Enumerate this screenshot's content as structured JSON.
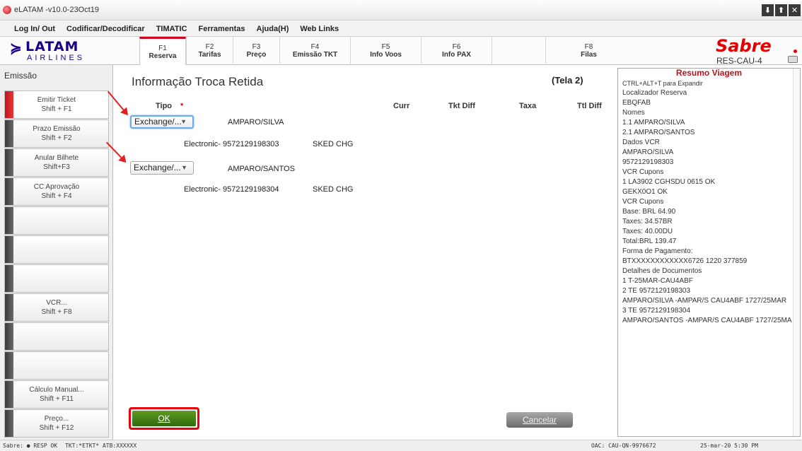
{
  "window": {
    "title": "eLATAM -v10.0-23Oct19",
    "controls": [
      "⬇",
      "⬆",
      "✕"
    ]
  },
  "menu": [
    "Log In/ Out",
    "Codificar/Decodificar",
    "TIMATIC",
    "Ferramentas",
    "Ajuda(H)",
    "Web Links"
  ],
  "logo": {
    "brand": "LATAM",
    "sub": "AIRLINES"
  },
  "fkeys": [
    {
      "key": "F1",
      "label": "Reserva"
    },
    {
      "key": "F2",
      "label": "Tarifas"
    },
    {
      "key": "F3",
      "label": "Preço"
    },
    {
      "key": "F4",
      "label": "Emissão TKT"
    },
    {
      "key": "F5",
      "label": "Info Voos"
    },
    {
      "key": "F6",
      "label": "Info PAX"
    },
    {
      "key": "",
      "label": ""
    },
    {
      "key": "F8",
      "label": "Filas"
    }
  ],
  "sabre": {
    "logo": "Sabre",
    "station": "RES-CAU-4"
  },
  "sidebar": {
    "section": "Emissão",
    "buttons": [
      {
        "label": "Emitir Ticket",
        "shortcut": "Shift + F1"
      },
      {
        "label": "Prazo Emissão",
        "shortcut": "Shift + F2"
      },
      {
        "label": "Anular Bilhete",
        "shortcut": "Shift+F3"
      },
      {
        "label": "CC Aprovação",
        "shortcut": "Shift + F4"
      },
      {
        "label": "",
        "shortcut": ""
      },
      {
        "label": "",
        "shortcut": ""
      },
      {
        "label": "",
        "shortcut": ""
      },
      {
        "label": "VCR...",
        "shortcut": "Shift + F8"
      },
      {
        "label": "",
        "shortcut": ""
      },
      {
        "label": "",
        "shortcut": ""
      },
      {
        "label": "Cálculo Manual...",
        "shortcut": "Shift + F11"
      },
      {
        "label": "Preço...",
        "shortcut": "Shift + F12"
      }
    ]
  },
  "main": {
    "title": "Informação Troca Retida",
    "screen": "(Tela 2)",
    "columns": {
      "tipo": "Tipo",
      "required": "*",
      "curr": "Curr",
      "tkt_diff": "Tkt Diff",
      "taxa": "Taxa",
      "ttl_diff": "Ttl Diff"
    },
    "passengers": [
      {
        "type": "Exchange/...",
        "name": "AMPARO/SILVA",
        "ticket": "Electronic- 9572129198303",
        "status": "SKED CHG"
      },
      {
        "type": "Exchange/...",
        "name": "AMPARO/SANTOS",
        "ticket": "Electronic- 9572129198304",
        "status": "SKED CHG"
      }
    ],
    "ok_label": "OK",
    "cancel_label": "Cancelar"
  },
  "summary": {
    "title": "Resumo Viagem",
    "lines": [
      "CTRL+ALT+T para Expandir",
      "Localizador Reserva",
      "EBQFAB",
      " Nomes",
      "1.1 AMPARO/SILVA",
      "2.1 AMPARO/SANTOS",
      " Dados VCR",
      "AMPARO/SILVA",
      "9572129198303",
      " VCR Cupons",
      "1 LA3902 CGHSDU 0615 OK",
      "GEKX0O1 OK",
      " VCR Cupons",
      "Base: BRL   64.90",
      "Taxes:  34.57BR",
      "Taxes:  40.00DU",
      "Total:BRL  139.47",
      "Forma de Pagamento:",
      "BTXXXXXXXXXXXX6726 1220 377859",
      "Detalhes de Documentos",
      "1 T-25MAR-CAU4ABF",
      "2 TE 9572129198303",
      "AMPARO/SILVA -AMPAR/S CAU4ABF 1727/25MAR",
      "3 TE 9572129198304",
      "AMPARO/SANTOS -AMPAR/S CAU4ABF 1727/25MA"
    ]
  },
  "status": {
    "sabre": "Sabre: ● RESP OK",
    "tkt": "TKT:*ETKT* ATB:XXXXXX",
    "oac": "OAC: CAU-QN-9976672",
    "datetime": "25-mar-20 5:30 PM"
  }
}
